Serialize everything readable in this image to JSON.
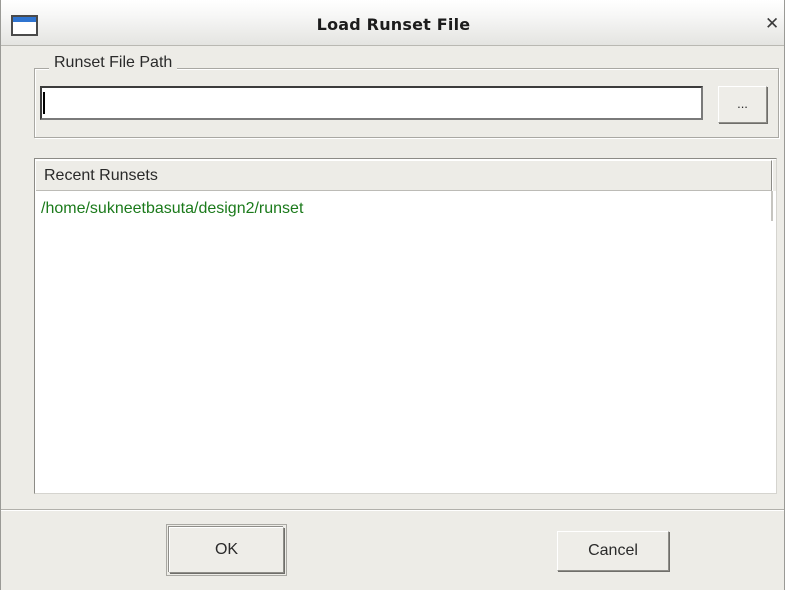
{
  "window": {
    "title": "Load Runset File",
    "close_icon": "close-icon",
    "app_icon": "window-icon"
  },
  "runset_path": {
    "legend": "Runset File Path",
    "value": "",
    "browse_label": "..."
  },
  "recent": {
    "header": "Recent Runsets",
    "items": [
      "/home/sukneetbasuta/design2/runset"
    ]
  },
  "buttons": {
    "ok_label": "OK",
    "cancel_label": "Cancel"
  },
  "colors": {
    "recent_item_text": "#1b7a1b",
    "title_icon_accent": "#2f74d0"
  }
}
